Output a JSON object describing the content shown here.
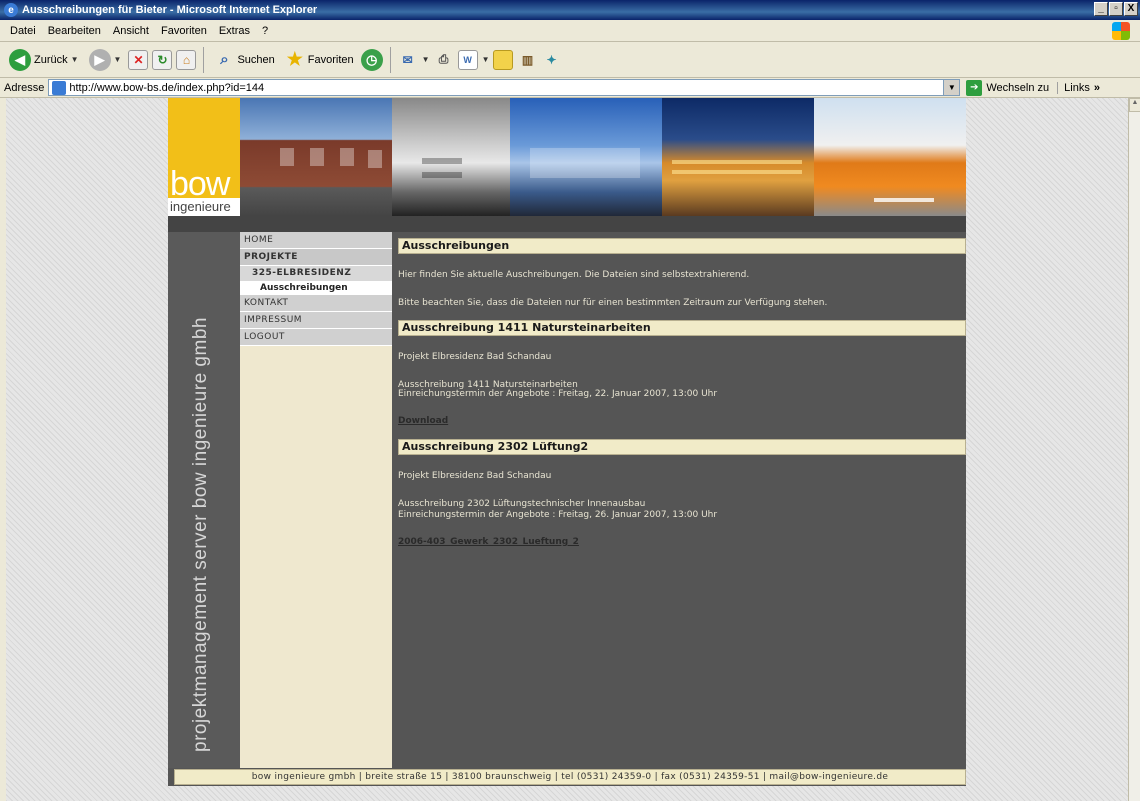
{
  "window": {
    "title": "Ausschreibungen für Bieter - Microsoft Internet Explorer",
    "min": "_",
    "max": "▫",
    "close": "X"
  },
  "menu": [
    "Datei",
    "Bearbeiten",
    "Ansicht",
    "Favoriten",
    "Extras",
    "?"
  ],
  "toolbar": {
    "back": "Zurück",
    "search": "Suchen",
    "favorites": "Favoriten"
  },
  "address": {
    "label": "Adresse",
    "url": "http://www.bow-bs.de/index.php?id=144",
    "go": "Wechseln zu",
    "links": "Links"
  },
  "site": {
    "logo_main": "bow",
    "logo_sub": "ingenieure",
    "side_text": "projektmanagement server bow ingenieure gmbh",
    "nav": {
      "home": "HOME",
      "projekte": "PROJEKTE",
      "project": "325-ELBRESIDENZ",
      "ausschreibungen": "Ausschreibungen",
      "kontakt": "KONTAKT",
      "impressum": "IMPRESSUM",
      "logout": "LOGOUT"
    },
    "main": {
      "heading": "Ausschreibungen",
      "intro1": "Hier finden Sie aktuelle Auschreibungen. Die Dateien sind selbstextrahierend.",
      "intro2": "Bitte beachten Sie, dass die Dateien nur für einen bestimmten Zeitraum zur Verfügung stehen.",
      "tenders": [
        {
          "heading": "Ausschreibung 1411 Natursteinarbeiten",
          "project": "Projekt Elbresidenz Bad Schandau",
          "line1": "Ausschreibung 1411 Natursteinarbeiten",
          "line2": "Einreichungstermin der Angebote : Freitag, 22. Januar 2007, 13:00 Uhr",
          "link": "Download"
        },
        {
          "heading": "Ausschreibung 2302 Lüftung2",
          "project": "Projekt Elbresidenz Bad Schandau",
          "line1": "Ausschreibung 2302 Lüftungstechnischer Innenausbau",
          "line2": "Einreichungstermin der Angebote : Freitag, 26. Januar 2007, 13:00 Uhr",
          "link": "2006-403_Gewerk_2302_Lueftung_2"
        }
      ]
    },
    "footer": "bow ingenieure gmbh | breite straße 15 | 38100 braunschweig | tel (0531) 24359-0 | fax (0531) 24359-51 | mail@bow-ingenieure.de"
  }
}
